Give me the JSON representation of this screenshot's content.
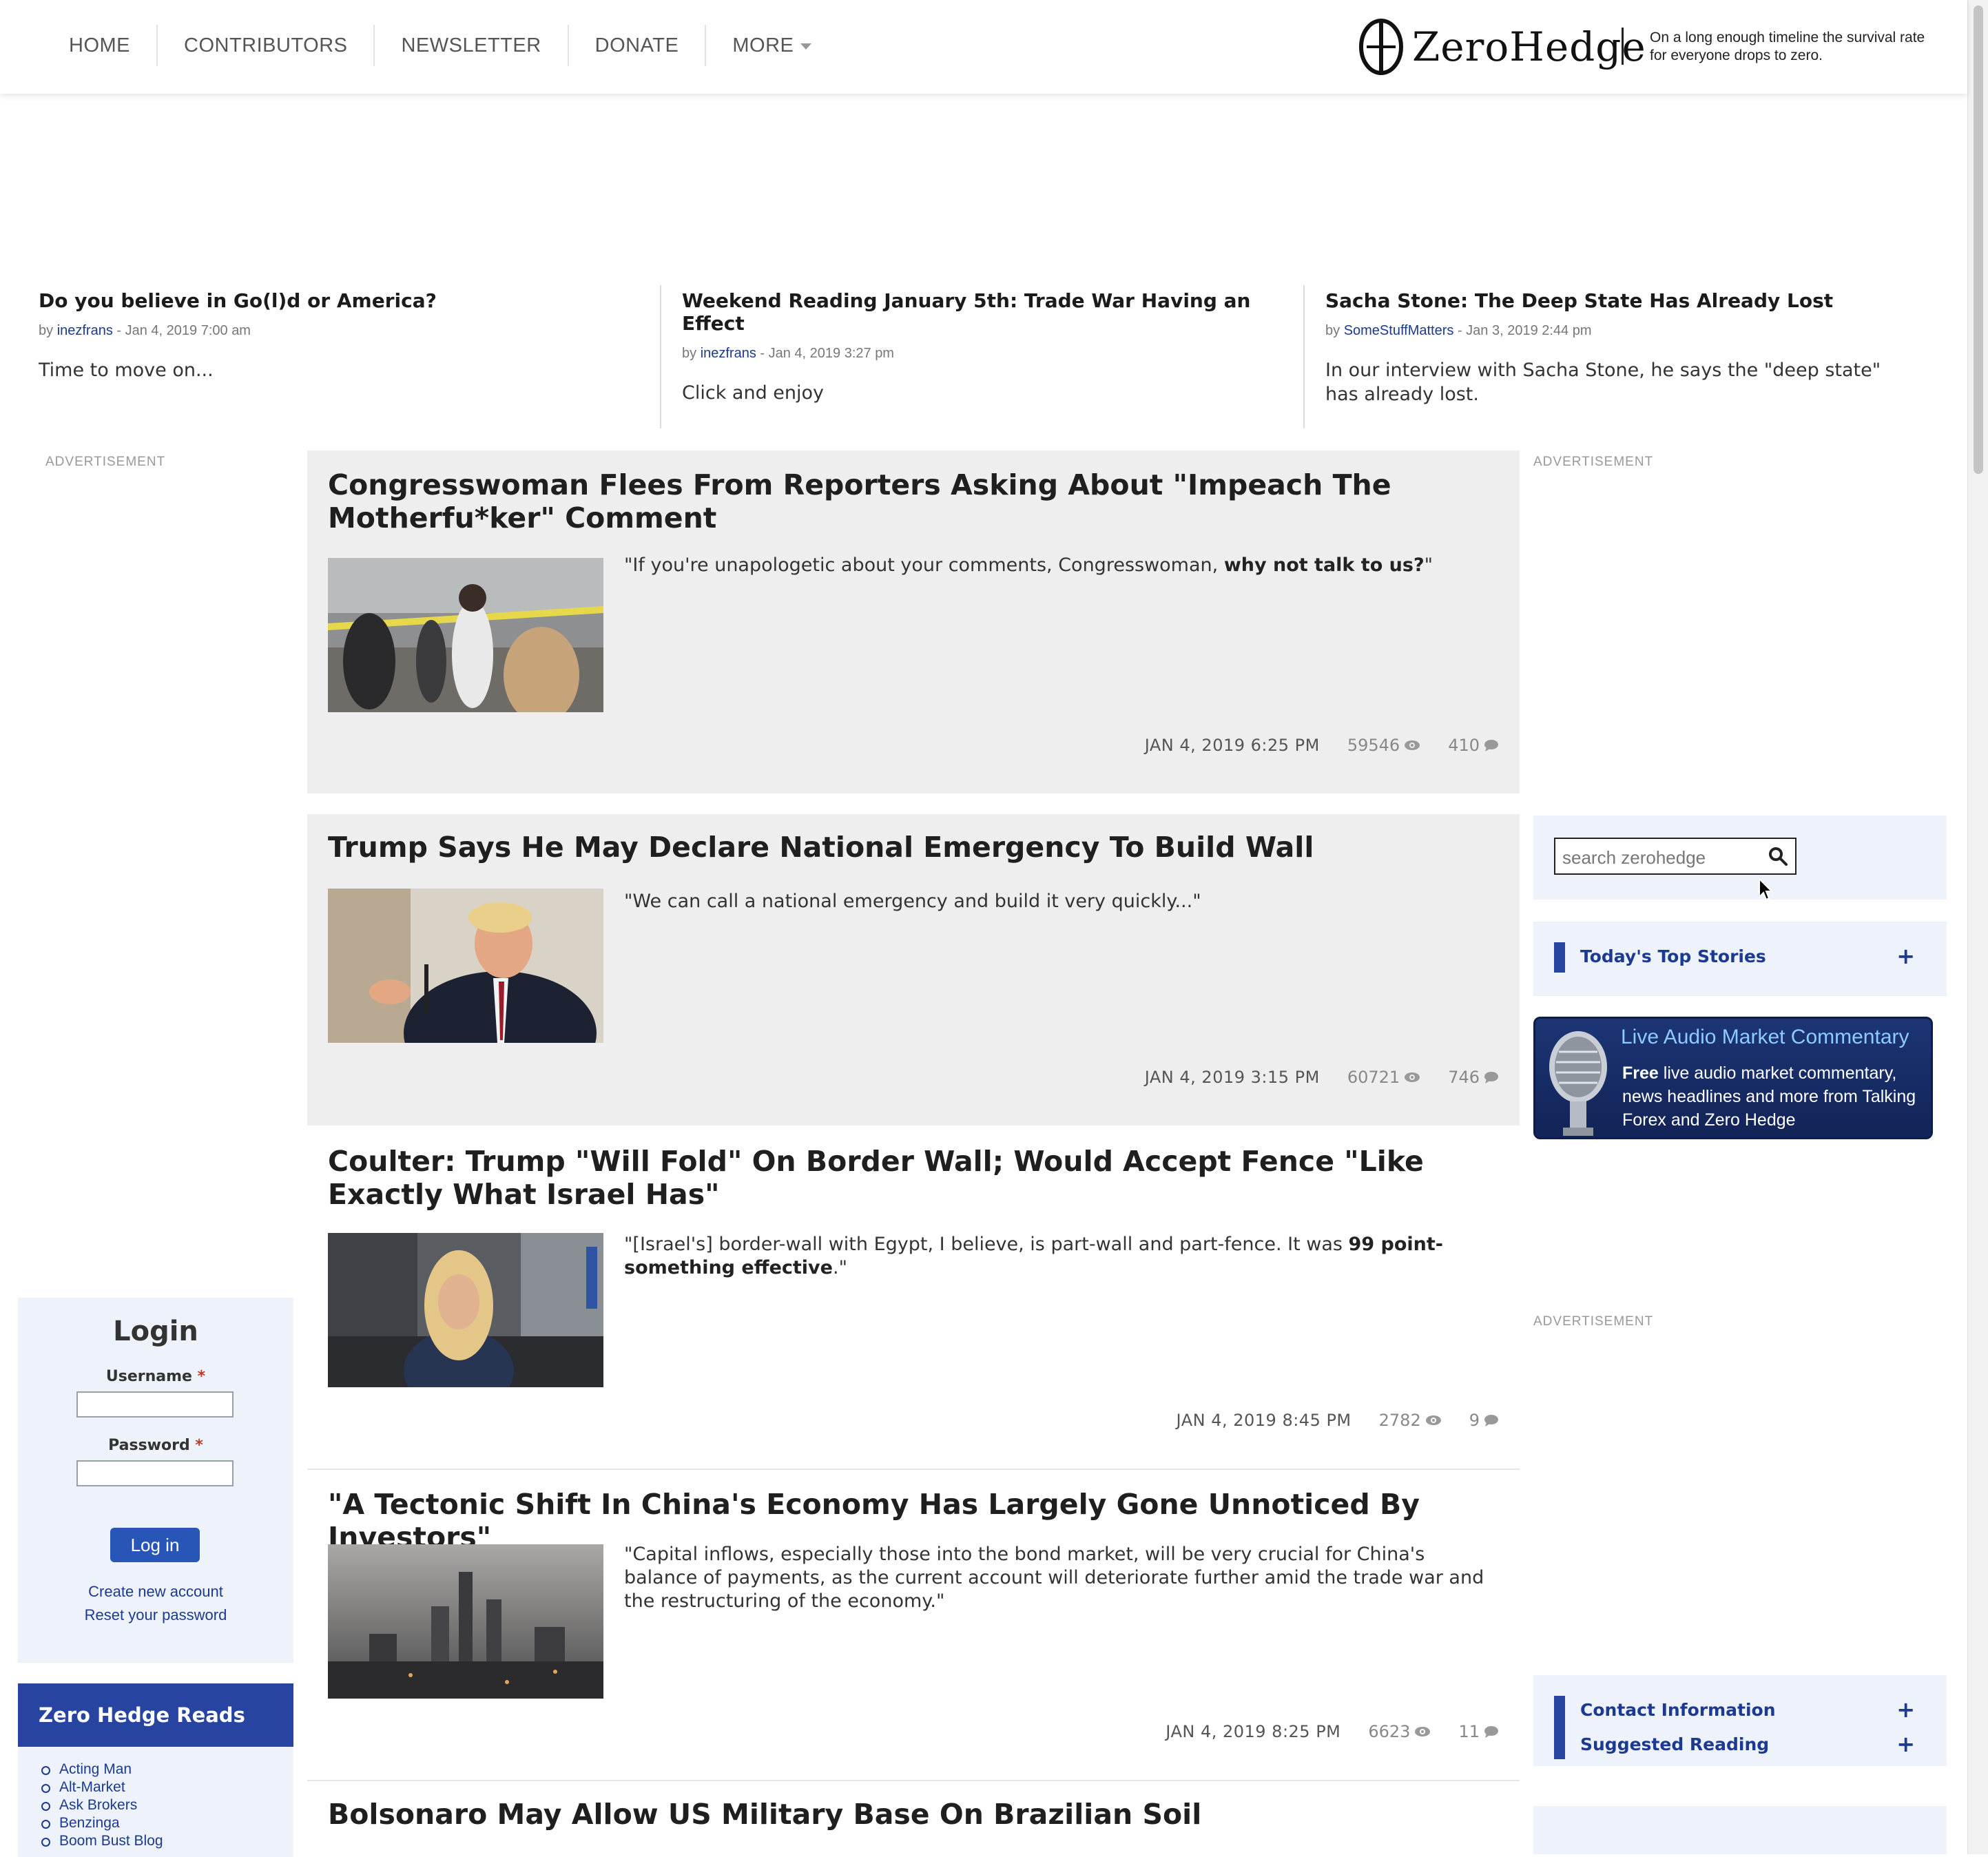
{
  "nav": {
    "items": [
      "HOME",
      "CONTRIBUTORS",
      "NEWSLETTER",
      "DONATE",
      "MORE"
    ],
    "logo_text": "ZeroHedge",
    "tagline": "On a long enough timeline the survival rate for everyone drops to zero."
  },
  "featured": [
    {
      "title": "Do you believe in Go(l)d or America?",
      "by": "by",
      "author": "inezfrans",
      "date": " - Jan 4, 2019 7:00 am",
      "body": "Time to move on..."
    },
    {
      "title": "Weekend Reading January 5th: Trade War Having an Effect",
      "by": "by",
      "author": "inezfrans",
      "date": " - Jan 4, 2019 3:27 pm",
      "body": "Click and enjoy"
    },
    {
      "title": "Sacha Stone: The Deep State Has Already Lost",
      "by": "by",
      "author": "SomeStuffMatters",
      "date": " - Jan 3, 2019 2:44 pm",
      "body": "In our interview with Sacha Stone, he says the \"deep state\" has already lost."
    }
  ],
  "advertisement_label": "ADVERTISEMENT",
  "articles": [
    {
      "title": "Congresswoman Flees From Reporters Asking About \"Impeach The Motherfu*ker\" Comment",
      "teaser_plain": "\"If you're unapologetic about your comments, Congresswoman, ",
      "teaser_bold": "why not talk to us?",
      "teaser_end": "\"",
      "date": "JAN 4, 2019 6:25 PM",
      "views": "59546",
      "comments": "410"
    },
    {
      "title": "Trump Says He May Declare National Emergency To Build Wall",
      "teaser_plain": "\"We can call a national emergency and build it very quickly...\"",
      "teaser_bold": "",
      "teaser_end": "",
      "date": "JAN 4, 2019 3:15 PM",
      "views": "60721",
      "comments": "746"
    },
    {
      "title": "Coulter: Trump \"Will Fold\" On Border Wall; Would Accept Fence \"Like Exactly What Israel Has\"",
      "teaser_plain": "\"[Israel's] border-wall with Egypt, I believe, is part-wall and part-fence. It was ",
      "teaser_bold": "99 point-something effective",
      "teaser_end": ".\"",
      "date": "JAN 4, 2019 8:45 PM",
      "views": "2782",
      "comments": "9"
    },
    {
      "title": "\"A Tectonic Shift In China's Economy Has Largely Gone Unnoticed By Investors\"",
      "teaser_plain": "\"Capital inflows, especially those into the bond market, will be very crucial for China's balance of payments, as the current account will deteriorate further amid the trade war and the restructuring of the economy.\"",
      "teaser_bold": "",
      "teaser_end": "",
      "date": "JAN 4, 2019 8:25 PM",
      "views": "6623",
      "comments": "11"
    },
    {
      "title": "Bolsonaro May Allow US Military Base On Brazilian Soil"
    }
  ],
  "login": {
    "title": "Login",
    "username_label": "Username",
    "password_label": "Password",
    "required_mark": "*",
    "button": "Log in",
    "create_account": "Create new account",
    "reset_password": "Reset your password"
  },
  "reads": {
    "title": "Zero Hedge Reads",
    "items": [
      "Acting Man",
      "Alt-Market",
      "Ask Brokers",
      "Benzinga",
      "Boom Bust Blog"
    ]
  },
  "sidebar": {
    "search_placeholder": "search zerohedge",
    "top_stories": "Today's Top Stories",
    "contact": "Contact Information",
    "suggested": "Suggested Reading",
    "plus": "+"
  },
  "audio_banner": {
    "title": "Live Audio Market Commentary",
    "body_bold": "Free",
    "body_rest": " live audio market commentary, news headlines and more from Talking Forex and Zero Hedge"
  },
  "colors": {
    "accent": "#2745a0",
    "link": "#1c3a8f",
    "panel": "#eef3fb",
    "shaded": "#eeeeee"
  }
}
